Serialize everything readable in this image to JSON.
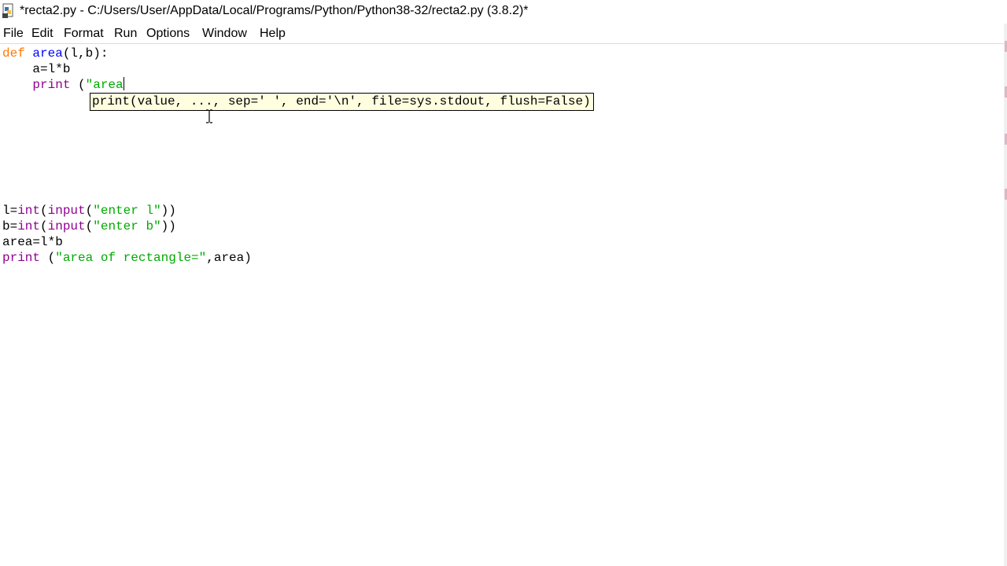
{
  "window": {
    "title": "*recta2.py - C:/Users/User/AppData/Local/Programs/Python/Python38-32/recta2.py (3.8.2)*",
    "app_icon": "python-file-icon"
  },
  "menu": {
    "items": [
      "File",
      "Edit",
      "Format",
      "Run",
      "Options",
      "Window",
      "Help"
    ]
  },
  "editor": {
    "lines": {
      "l1": {
        "kw": "def",
        "fn": "area",
        "rest": "(l,b):"
      },
      "l2": {
        "indent": "    ",
        "text": "a=l*b"
      },
      "l3": {
        "indent": "    ",
        "bi": "print",
        "sp": " (",
        "str": "\"area"
      },
      "l4": {
        "text": "l=",
        "bi1": "int",
        "p1": "(",
        "bi2": "input",
        "p2": "(",
        "str": "\"enter l\"",
        "end": "))"
      },
      "l5": {
        "text": "b=",
        "bi1": "int",
        "p1": "(",
        "bi2": "input",
        "p2": "(",
        "str": "\"enter b\"",
        "end": "))"
      },
      "l6": {
        "text": "area=l*b"
      },
      "l7": {
        "bi": "print",
        "sp": " (",
        "str": "\"area of rectangle=\"",
        "end": ",area)"
      }
    },
    "calltip": "print(value, ..., sep=' ', end='\\n', file=sys.stdout, flush=False)"
  },
  "colors": {
    "keyword": "#ff7700",
    "builtin": "#900090",
    "definition": "#0000ff",
    "string": "#00aa00",
    "calltip_bg": "#ffffe0"
  },
  "cursor": {
    "icon": "text-ibeam-cursor"
  }
}
